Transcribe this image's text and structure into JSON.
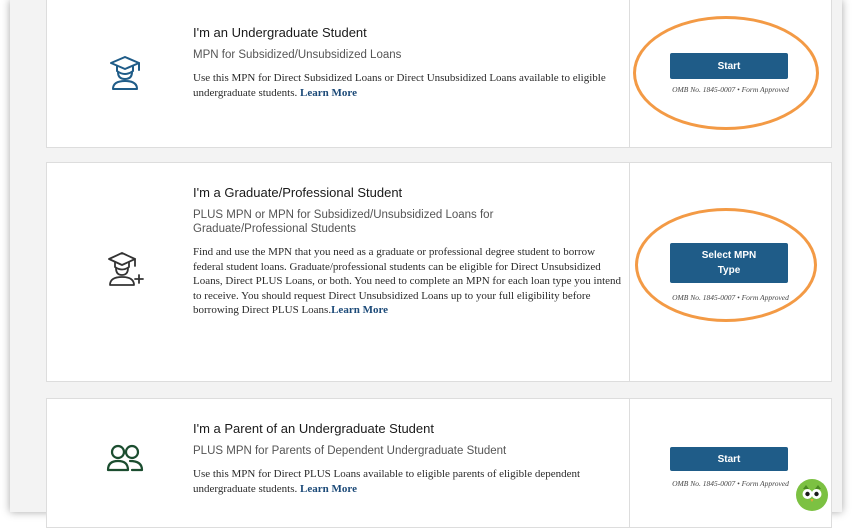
{
  "cards": [
    {
      "title": "I'm an Undergraduate Student",
      "subtitle": "MPN for Subsidized/Unsubsidized Loans",
      "description": "Use this MPN for Direct Subsidized Loans or Direct Unsubsidized Loans available to eligible undergraduate students. ",
      "learn_more": "Learn More",
      "button_label": "Start",
      "omb": "OMB No. 1845-0007 • Form Approved",
      "icon": "graduate-student-icon"
    },
    {
      "title": "I'm a Graduate/Professional Student",
      "subtitle": "PLUS MPN or MPN for Subsidized/Unsubsidized Loans for Graduate/Professional Students",
      "description": "Find and use the MPN that you need as a graduate or professional degree student to borrow federal student loans. Graduate/professional students can be eligible for Direct Unsubsidized Loans, Direct PLUS Loans, or both. You need to complete an MPN for each loan type you intend to receive. You should request Direct Unsubsidized Loans up to your full eligibility before borrowing Direct PLUS Loans.",
      "learn_more": "Learn More",
      "button_label": "Select MPN Type",
      "omb": "OMB No. 1845-0007 • Form Approved",
      "icon": "graduate-student-plus-icon"
    },
    {
      "title": "I'm a Parent of an Undergraduate Student",
      "subtitle": "PLUS MPN for Parents of Dependent Undergraduate Student",
      "description": "Use this MPN for Direct PLUS Loans available to eligible parents of eligible dependent undergraduate students. ",
      "learn_more": "Learn More",
      "button_label": "Start",
      "omb": "OMB No. 1845-0007 • Form Approved",
      "icon": "parent-users-icon"
    }
  ],
  "colors": {
    "button": "#1f5c88",
    "highlight_ring": "#f39a45",
    "icon": "#1f5c88",
    "parent_icon": "#1b4d2f",
    "link": "#1c4a78"
  }
}
